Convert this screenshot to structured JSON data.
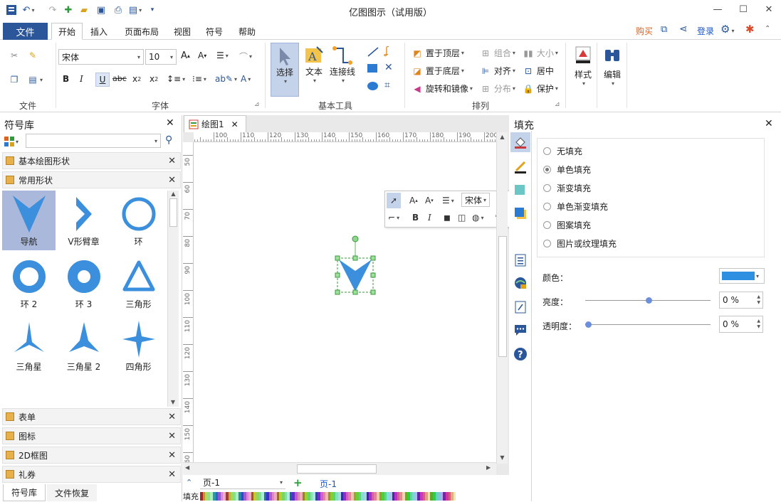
{
  "title": "亿图图示（试用版）",
  "menu": {
    "file": "文件",
    "tabs": [
      "开始",
      "插入",
      "页面布局",
      "视图",
      "符号",
      "帮助"
    ],
    "right": {
      "buy": "购买",
      "login": "登录"
    }
  },
  "ribbon": {
    "groups": {
      "file": "文件",
      "font": "字体",
      "basic_tools": "基本工具",
      "arrange": "排列"
    },
    "font_name": "宋体",
    "font_size": "10",
    "tools": {
      "select": "选择",
      "text": "文本",
      "connector": "连接线"
    },
    "arrange": {
      "bring_front": "置于顶层",
      "send_back": "置于底层",
      "rotate": "旋转和镜像",
      "group": "组合",
      "align": "对齐",
      "distribute": "分布",
      "size": "大小",
      "center": "居中",
      "protect": "保护"
    },
    "style": "样式",
    "edit": "编辑"
  },
  "library": {
    "title": "符号库",
    "search_placeholder": "",
    "sections": {
      "basic": "基本绘图形状",
      "common": "常用形状"
    },
    "shapes": [
      {
        "label": "导航"
      },
      {
        "label": "V形臂章"
      },
      {
        "label": "环"
      },
      {
        "label": "环 2"
      },
      {
        "label": "环 3"
      },
      {
        "label": "三角形"
      },
      {
        "label": "三角星"
      },
      {
        "label": "三角星 2"
      },
      {
        "label": "四角形"
      },
      {
        "label": ""
      },
      {
        "label": ""
      },
      {
        "label": ""
      }
    ],
    "bottom_sections": {
      "form": "表单",
      "icon": "图标",
      "frame2d": "2D框图",
      "coupon": "礼券"
    },
    "bottom_tabs": {
      "library": "符号库",
      "recovery": "文件恢复"
    }
  },
  "document": {
    "tab": "绘图1",
    "hruler": [
      "100",
      "110",
      "120",
      "130",
      "140",
      "150",
      "160",
      "170",
      "180",
      "190",
      "200"
    ],
    "vruler": [
      "50",
      "60",
      "70",
      "80",
      "90",
      "100",
      "110",
      "120",
      "130",
      "140",
      "150",
      "160"
    ],
    "page_label": "页-1",
    "page_tab": "页-1",
    "fill_label": "填充"
  },
  "floating_toolbar": {
    "font": "宋体"
  },
  "fill_panel": {
    "title": "填充",
    "options": [
      {
        "label": "无填充",
        "checked": false
      },
      {
        "label": "单色填充",
        "checked": true
      },
      {
        "label": "渐变填充",
        "checked": false
      },
      {
        "label": "单色渐变填充",
        "checked": false
      },
      {
        "label": "图案填充",
        "checked": false
      },
      {
        "label": "图片或纹理填充",
        "checked": false
      }
    ],
    "color_label": "颜色：",
    "color": "#2f8fe0",
    "brightness_label": "亮度：",
    "brightness": "0 %",
    "transparency_label": "透明度：",
    "transparency": "0 %"
  },
  "colors": {
    "accent": "#2b579a",
    "shape": "#3b8fdc",
    "buy": "#e0601c",
    "login": "#1a56c8"
  }
}
